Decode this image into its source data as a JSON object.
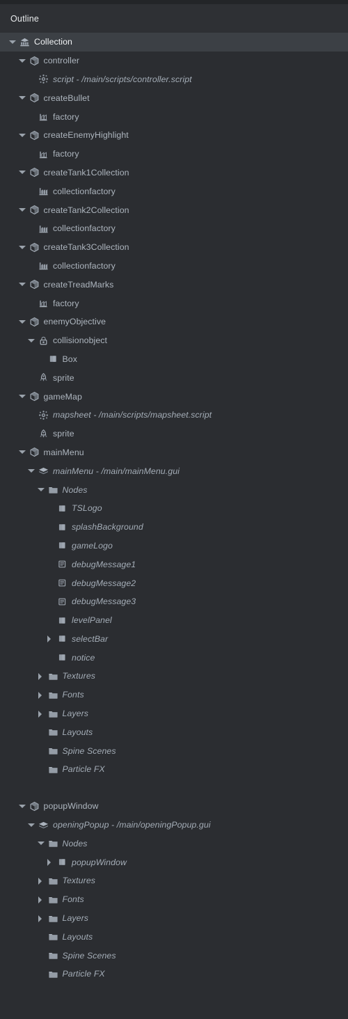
{
  "window": {
    "panel_title": "Outline",
    "background": "#2b2d31",
    "header_background": "#2e3034",
    "selected_row_background": "#3c4045",
    "text_color": "#aeb6bf",
    "selected_text_color": "#f2f4f6"
  },
  "tree": {
    "nodes": [
      {
        "label": "Collection",
        "icon": "collection-icon",
        "depth": 0,
        "twisty": "down",
        "italic": false,
        "selected": true
      },
      {
        "label": "controller",
        "icon": "game-object-icon",
        "depth": 1,
        "twisty": "down",
        "italic": false,
        "selected": false
      },
      {
        "label": "script - /main/scripts/controller.script",
        "icon": "script-icon",
        "depth": 2,
        "twisty": "none",
        "italic": true,
        "selected": false
      },
      {
        "label": "createBullet",
        "icon": "game-object-icon",
        "depth": 1,
        "twisty": "down",
        "italic": false,
        "selected": false
      },
      {
        "label": "factory",
        "icon": "factory-icon",
        "depth": 2,
        "twisty": "none",
        "italic": false,
        "selected": false
      },
      {
        "label": "createEnemyHighlight",
        "icon": "game-object-icon",
        "depth": 1,
        "twisty": "down",
        "italic": false,
        "selected": false
      },
      {
        "label": "factory",
        "icon": "factory-icon",
        "depth": 2,
        "twisty": "none",
        "italic": false,
        "selected": false
      },
      {
        "label": "createTank1Collection",
        "icon": "game-object-icon",
        "depth": 1,
        "twisty": "down",
        "italic": false,
        "selected": false
      },
      {
        "label": "collectionfactory",
        "icon": "collection-factory-icon",
        "depth": 2,
        "twisty": "none",
        "italic": false,
        "selected": false
      },
      {
        "label": "createTank2Collection",
        "icon": "game-object-icon",
        "depth": 1,
        "twisty": "down",
        "italic": false,
        "selected": false
      },
      {
        "label": "collectionfactory",
        "icon": "collection-factory-icon",
        "depth": 2,
        "twisty": "none",
        "italic": false,
        "selected": false
      },
      {
        "label": "createTank3Collection",
        "icon": "game-object-icon",
        "depth": 1,
        "twisty": "down",
        "italic": false,
        "selected": false
      },
      {
        "label": "collectionfactory",
        "icon": "collection-factory-icon",
        "depth": 2,
        "twisty": "none",
        "italic": false,
        "selected": false
      },
      {
        "label": "createTreadMarks",
        "icon": "game-object-icon",
        "depth": 1,
        "twisty": "down",
        "italic": false,
        "selected": false
      },
      {
        "label": "factory",
        "icon": "factory-icon",
        "depth": 2,
        "twisty": "none",
        "italic": false,
        "selected": false
      },
      {
        "label": "enemyObjective",
        "icon": "game-object-icon",
        "depth": 1,
        "twisty": "down",
        "italic": false,
        "selected": false
      },
      {
        "label": "collisionobject",
        "icon": "collision-object-icon",
        "depth": 2,
        "twisty": "down",
        "italic": false,
        "selected": false
      },
      {
        "label": "Box",
        "icon": "box-shape-icon",
        "depth": 3,
        "twisty": "none",
        "italic": false,
        "selected": false
      },
      {
        "label": "sprite",
        "icon": "sprite-icon",
        "depth": 2,
        "twisty": "none",
        "italic": false,
        "selected": false
      },
      {
        "label": "gameMap",
        "icon": "game-object-icon",
        "depth": 1,
        "twisty": "down",
        "italic": false,
        "selected": false
      },
      {
        "label": "mapsheet - /main/scripts/mapsheet.script",
        "icon": "script-icon",
        "depth": 2,
        "twisty": "none",
        "italic": true,
        "selected": false
      },
      {
        "label": "sprite",
        "icon": "sprite-icon",
        "depth": 2,
        "twisty": "none",
        "italic": false,
        "selected": false
      },
      {
        "label": "mainMenu",
        "icon": "game-object-icon",
        "depth": 1,
        "twisty": "down",
        "italic": false,
        "selected": false
      },
      {
        "label": "mainMenu - /main/mainMenu.gui",
        "icon": "gui-icon",
        "depth": 2,
        "twisty": "down",
        "italic": true,
        "selected": false
      },
      {
        "label": "Nodes",
        "icon": "folder-icon",
        "depth": 3,
        "twisty": "down",
        "italic": true,
        "selected": false
      },
      {
        "label": "TSLogo",
        "icon": "gui-box-node-icon",
        "depth": 4,
        "twisty": "none",
        "italic": true,
        "selected": false
      },
      {
        "label": "splashBackground",
        "icon": "gui-box-node-icon",
        "depth": 4,
        "twisty": "none",
        "italic": true,
        "selected": false
      },
      {
        "label": "gameLogo",
        "icon": "gui-box-node-icon",
        "depth": 4,
        "twisty": "none",
        "italic": true,
        "selected": false
      },
      {
        "label": "debugMessage1",
        "icon": "gui-text-node-icon",
        "depth": 4,
        "twisty": "none",
        "italic": true,
        "selected": false
      },
      {
        "label": "debugMessage2",
        "icon": "gui-text-node-icon",
        "depth": 4,
        "twisty": "none",
        "italic": true,
        "selected": false
      },
      {
        "label": "debugMessage3",
        "icon": "gui-text-node-icon",
        "depth": 4,
        "twisty": "none",
        "italic": true,
        "selected": false
      },
      {
        "label": "levelPanel",
        "icon": "gui-box-node-icon",
        "depth": 4,
        "twisty": "none",
        "italic": true,
        "selected": false
      },
      {
        "label": "selectBar",
        "icon": "gui-box-node-icon",
        "depth": 4,
        "twisty": "right",
        "italic": true,
        "selected": false
      },
      {
        "label": "notice",
        "icon": "gui-box-node-icon",
        "depth": 4,
        "twisty": "none",
        "italic": true,
        "selected": false
      },
      {
        "label": "Textures",
        "icon": "folder-icon",
        "depth": 3,
        "twisty": "right",
        "italic": true,
        "selected": false
      },
      {
        "label": "Fonts",
        "icon": "folder-icon",
        "depth": 3,
        "twisty": "right",
        "italic": true,
        "selected": false
      },
      {
        "label": "Layers",
        "icon": "folder-icon",
        "depth": 3,
        "twisty": "right",
        "italic": true,
        "selected": false
      },
      {
        "label": "Layouts",
        "icon": "folder-icon",
        "depth": 3,
        "twisty": "none",
        "italic": true,
        "selected": false
      },
      {
        "label": "Spine Scenes",
        "icon": "folder-icon",
        "depth": 3,
        "twisty": "none",
        "italic": true,
        "selected": false
      },
      {
        "label": "Particle FX",
        "icon": "folder-icon",
        "depth": 3,
        "twisty": "none",
        "italic": true,
        "selected": false
      },
      {
        "label": "",
        "icon": "spacer",
        "depth": 0,
        "twisty": "none",
        "italic": false,
        "selected": false
      },
      {
        "label": "popupWindow",
        "icon": "game-object-icon",
        "depth": 1,
        "twisty": "down",
        "italic": false,
        "selected": false
      },
      {
        "label": "openingPopup - /main/openingPopup.gui",
        "icon": "gui-icon",
        "depth": 2,
        "twisty": "down",
        "italic": true,
        "selected": false
      },
      {
        "label": "Nodes",
        "icon": "folder-icon",
        "depth": 3,
        "twisty": "down",
        "italic": true,
        "selected": false
      },
      {
        "label": "popupWindow",
        "icon": "gui-box-node-icon",
        "depth": 4,
        "twisty": "right",
        "italic": true,
        "selected": false
      },
      {
        "label": "Textures",
        "icon": "folder-icon",
        "depth": 3,
        "twisty": "right",
        "italic": true,
        "selected": false
      },
      {
        "label": "Fonts",
        "icon": "folder-icon",
        "depth": 3,
        "twisty": "right",
        "italic": true,
        "selected": false
      },
      {
        "label": "Layers",
        "icon": "folder-icon",
        "depth": 3,
        "twisty": "right",
        "italic": true,
        "selected": false
      },
      {
        "label": "Layouts",
        "icon": "folder-icon",
        "depth": 3,
        "twisty": "none",
        "italic": true,
        "selected": false
      },
      {
        "label": "Spine Scenes",
        "icon": "folder-icon",
        "depth": 3,
        "twisty": "none",
        "italic": true,
        "selected": false
      },
      {
        "label": "Particle FX",
        "icon": "folder-icon",
        "depth": 3,
        "twisty": "none",
        "italic": true,
        "selected": false
      }
    ]
  }
}
